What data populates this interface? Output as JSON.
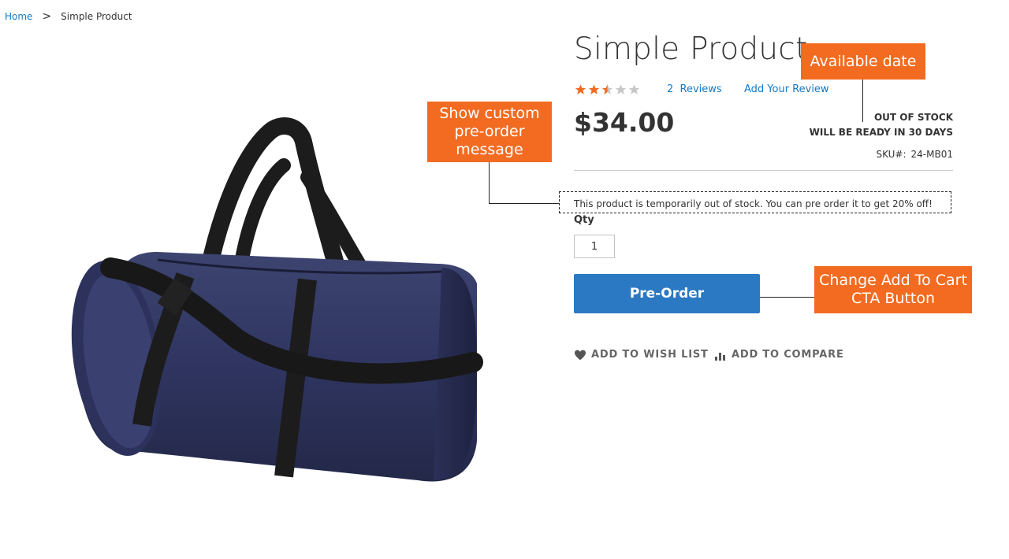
{
  "breadcrumb": {
    "home": "Home",
    "separator": ">",
    "current": "Simple Product"
  },
  "product": {
    "title": "Simple Product",
    "rating_stars": 2.5,
    "rating_max": 5,
    "reviews_count": "2",
    "reviews_label": "Reviews",
    "add_review": "Add Your Review",
    "price": "$34.00",
    "stock_status": "OUT OF STOCK",
    "availability": "WILL BE READY IN 30 DAYS",
    "sku_label": "SKU#:",
    "sku_value": "24-MB01",
    "preorder_message": "This product is temporarily out of stock. You can pre order it to get 20% off!",
    "qty_label": "Qty",
    "qty_value": "1",
    "cta_label": "Pre-Order",
    "wishlist_label": "ADD TO WISH LIST",
    "compare_label": "ADD TO COMPARE"
  },
  "callouts": {
    "available_date": "Available date",
    "custom_message": "Show custom\npre-order\nmessage",
    "cta_change": "Change Add To Cart\nCTA Button"
  },
  "icons": {
    "wishlist": "heart-icon",
    "compare": "bar-chart-icon",
    "star": "star-icon"
  },
  "colors": {
    "accent_link": "#1979c3",
    "button": "#2b79c3",
    "callout": "#f26b21",
    "star_filled": "#f26b21",
    "star_empty": "#c7c7c7"
  }
}
